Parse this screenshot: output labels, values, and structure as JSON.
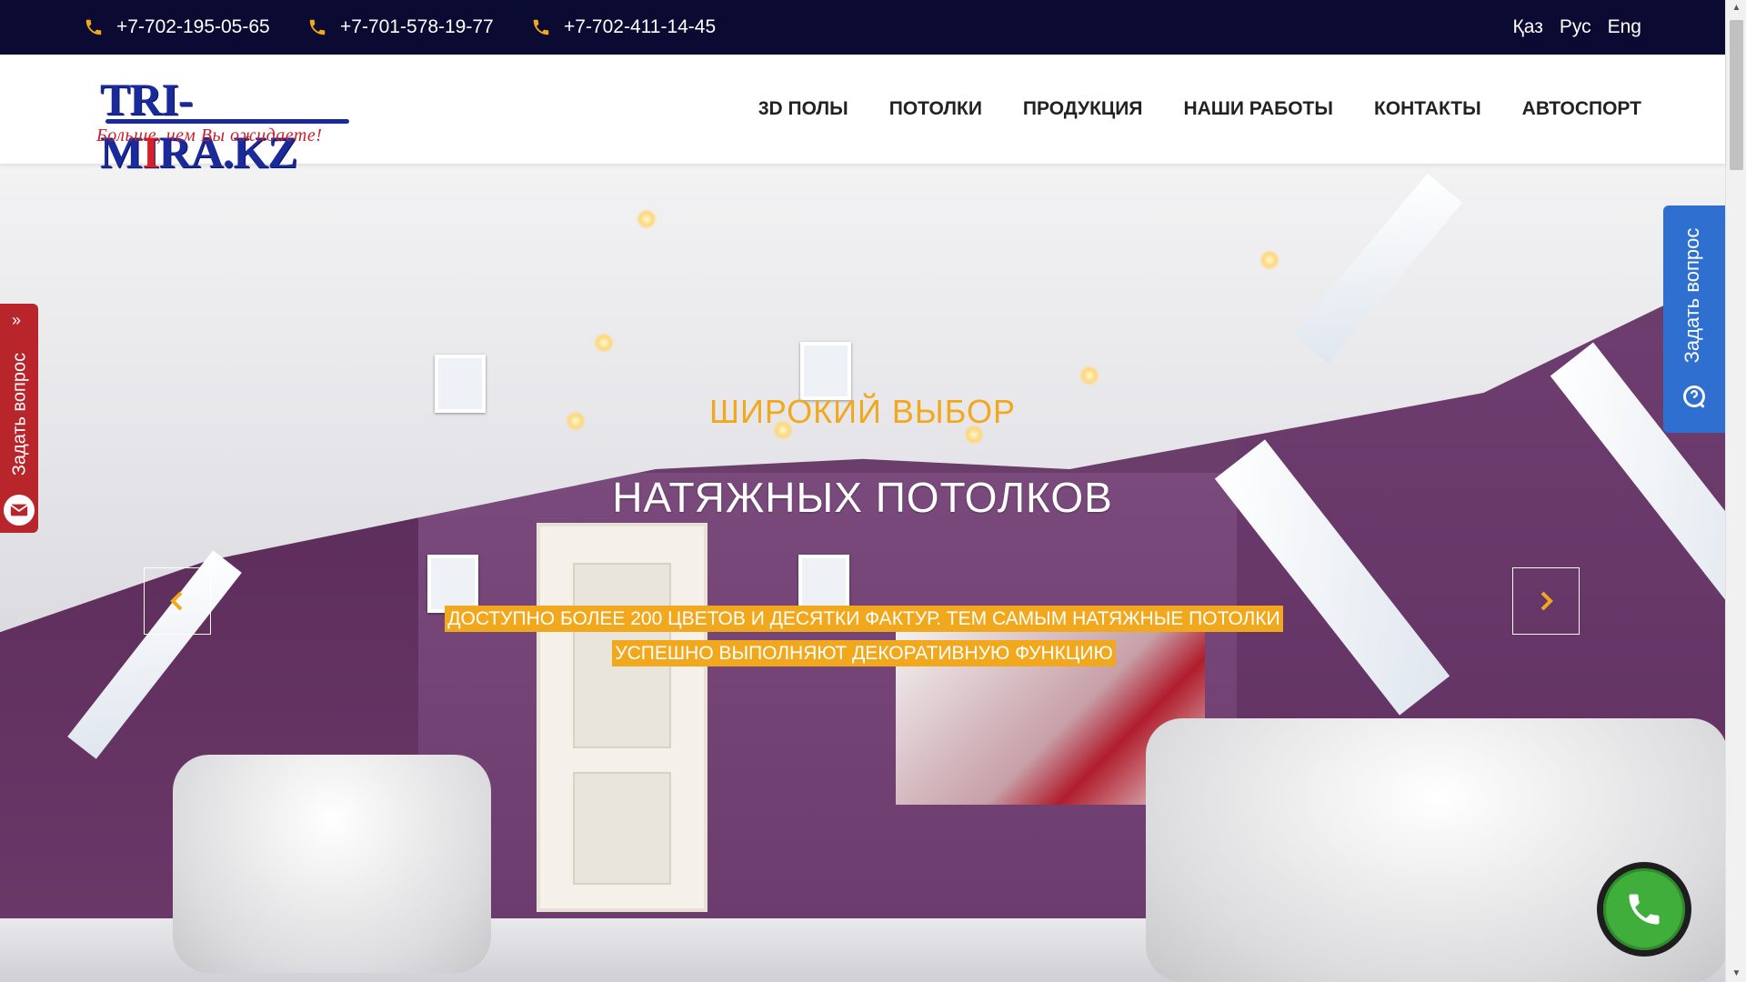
{
  "topbar": {
    "phones": [
      "+7-702-195-05-65",
      "+7-701-578-19-77",
      "+7-702-411-14-45"
    ],
    "languages": [
      "Қаз",
      "Рус",
      "Eng"
    ]
  },
  "logo": {
    "main_a": "TRI-M",
    "main_b": "I",
    "main_c": "RA.KZ",
    "tagline": "Больше, чем Вы ожидаете!"
  },
  "nav": [
    "3D ПОЛЫ",
    "ПОТОЛКИ",
    "ПРОДУКЦИЯ",
    "НАШИ РАБОТЫ",
    "КОНТАКТЫ",
    "АВТОСПОРТ"
  ],
  "hero": {
    "subtitle": "ШИРОКИЙ ВЫБОР",
    "title": "НАТЯЖНЫХ ПОТОЛКОВ",
    "description": "ДОСТУПНО БОЛЕЕ 200 ЦВЕТОВ И ДЕСЯТКИ ФАКТУР. ТЕМ САМЫМ НАТЯЖНЫЕ ПОТОЛКИ УСПЕШНО ВЫПОЛНЯЮТ ДЕКОРАТИВНУЮ ФУНКЦИЮ"
  },
  "side_tabs": {
    "left_label": "Задать вопрос",
    "right_label": "Задать вопрос"
  },
  "colors": {
    "topbar": "#0a0a32",
    "accent": "#f2a81d",
    "left_tab": "#b8252b",
    "right_tab": "#2e6fd0",
    "call_button": "#3fae3b"
  },
  "icons": [
    "phone-icon",
    "chevron-left-icon",
    "chevron-right-icon",
    "mail-icon",
    "question-chat-icon",
    "call-icon"
  ]
}
